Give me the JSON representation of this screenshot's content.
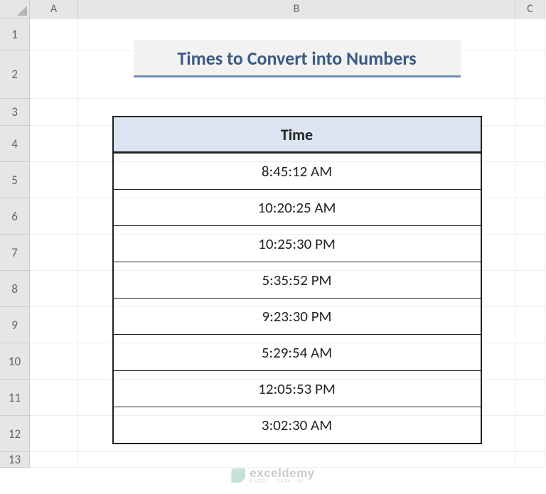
{
  "columns": [
    "A",
    "B",
    "C"
  ],
  "rows": [
    "1",
    "2",
    "3",
    "4",
    "5",
    "6",
    "7",
    "8",
    "9",
    "10",
    "11",
    "12",
    "13"
  ],
  "title": "Times to Convert into Numbers",
  "table": {
    "header": "Time",
    "values": [
      "8:45:12 AM",
      "10:20:25 AM",
      "10:25:30 PM",
      "5:35:52 PM",
      "9:23:30 PM",
      "5:29:54 AM",
      "12:05:53 PM",
      "3:02:30 AM"
    ]
  },
  "watermark": {
    "brand": "exceldemy",
    "tagline": "EXCEL · DATA · BI"
  }
}
